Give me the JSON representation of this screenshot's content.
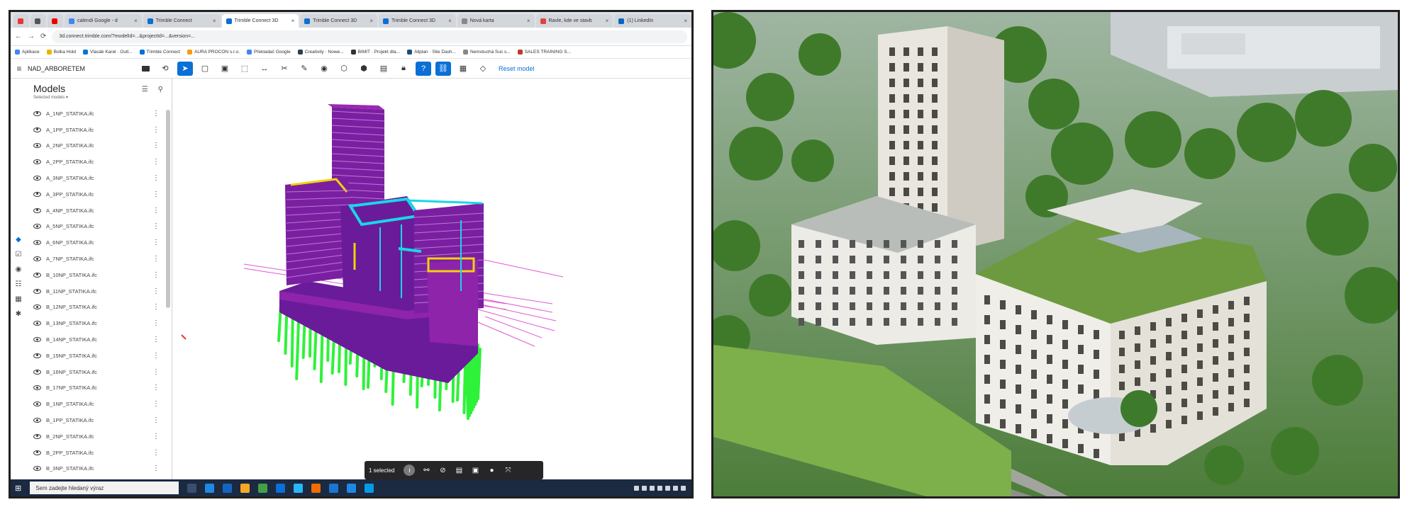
{
  "browser": {
    "tabs": [
      {
        "label": "",
        "fav": "#e33"
      },
      {
        "label": "",
        "fav": "#555"
      },
      {
        "label": "",
        "fav": "#e00"
      },
      {
        "label": "calendi Google - d",
        "fav": "#4285f4"
      },
      {
        "label": "Trimble Connect",
        "fav": "#0a6fd6"
      },
      {
        "label": "Trimble Connect 3D",
        "fav": "#0a6fd6"
      },
      {
        "label": "Trimble Connect 3D",
        "fav": "#0a6fd6"
      },
      {
        "label": "Trimble Connect 3D",
        "fav": "#0a6fd6"
      },
      {
        "label": "Nová karta",
        "fav": "#888"
      },
      {
        "label": "Ravle, kde ve stavb",
        "fav": "#d44"
      },
      {
        "label": "(1) LinkedIn",
        "fav": "#0a66c2"
      }
    ],
    "url": "3d.connect.trimble.com/?modelId=...&projectId=...&version=...",
    "bookmarks": [
      {
        "label": "Aplikace",
        "color": "#4285f4"
      },
      {
        "label": "Bolka Hold",
        "color": "#e8b400"
      },
      {
        "label": "Vlasák Karel · Outl...",
        "color": "#0078d4"
      },
      {
        "label": "Trimble Connect",
        "color": "#0a6fd6"
      },
      {
        "label": "AURA PROCON s.r.o.",
        "color": "#f39c12"
      },
      {
        "label": "Překladač Google",
        "color": "#4285f4"
      },
      {
        "label": "Creativity · Nowe...",
        "color": "#2c3e50"
      },
      {
        "label": "BIMIT · Projekt dta...",
        "color": "#333"
      },
      {
        "label": "Allplan · Site Dash...",
        "color": "#1f4e79"
      },
      {
        "label": "Nemotuchá Suc s...",
        "color": "#888"
      },
      {
        "label": "SALES TRAINING S...",
        "color": "#c0392b"
      }
    ]
  },
  "app": {
    "project_name": "NAD_ARBORETEM",
    "reset_label": "Reset model",
    "toolbar_icons": [
      "orbit-icon",
      "select-icon",
      "box-select-icon",
      "image-icon",
      "frame-icon",
      "measure-icon",
      "cut-icon",
      "markup-icon",
      "camera-icon",
      "shape-icon",
      "cube-icon",
      "layers-icon",
      "lock-icon",
      "help-icon",
      "link-icon",
      "calc-icon",
      "shield-icon"
    ]
  },
  "models_panel": {
    "title": "Models",
    "subtitle": "Selected models ▾",
    "items": [
      "A_1NP_STATIKA.ifc",
      "A_1PP_STATIKA.ifc",
      "A_2NP_STATIKA.ifc",
      "A_2PP_STATIKA.ifc",
      "A_3NP_STATIKA.ifc",
      "A_3PP_STATIKA.ifc",
      "A_4NP_STATIKA.ifc",
      "A_5NP_STATIKA.ifc",
      "A_6NP_STATIKA.ifc",
      "A_7NP_STATIKA.ifc",
      "B_10NP_STATIKA.ifc",
      "B_11NP_STATIKA.ifc",
      "B_12NP_STATIKA.ifc",
      "B_13NP_STATIKA.ifc",
      "B_14NP_STATIKA.ifc",
      "B_15NP_STATIKA.ifc",
      "B_16NP_STATIKA.ifc",
      "B_17NP_STATIKA.ifc",
      "B_1NP_STATIKA.ifc",
      "B_1PP_STATIKA.ifc",
      "B_2NP_STATIKA.ifc",
      "B_2PP_STATIKA.ifc",
      "B_3NP_STATIKA.ifc"
    ]
  },
  "selection": {
    "label": "1 selected"
  },
  "taskbar": {
    "search_placeholder": "Sem zadejte hledaný výraz"
  },
  "colors": {
    "structure": "#7b1fa2",
    "piles": "#2ef23a",
    "beams": "#19d6e8",
    "highlight": "#f2d20a",
    "accent": "#0a6fd6"
  }
}
